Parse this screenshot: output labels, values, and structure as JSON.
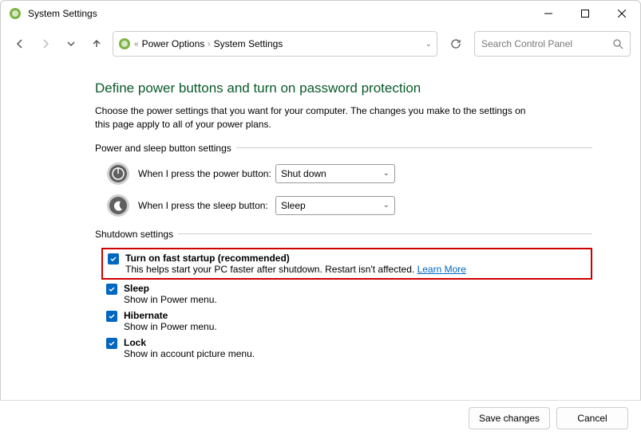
{
  "window": {
    "title": "System Settings"
  },
  "toolbar": {
    "breadcrumb": [
      "Power Options",
      "System Settings"
    ],
    "search_placeholder": "Search Control Panel"
  },
  "page": {
    "title": "Define power buttons and turn on password protection",
    "description": "Choose the power settings that you want for your computer. The changes you make to the settings on this page apply to all of your power plans."
  },
  "button_settings": {
    "legend": "Power and sleep button settings",
    "power": {
      "label": "When I press the power button:",
      "value": "Shut down"
    },
    "sleep": {
      "label": "When I press the sleep button:",
      "value": "Sleep"
    }
  },
  "shutdown": {
    "legend": "Shutdown settings",
    "fast_startup": {
      "label": "Turn on fast startup (recommended)",
      "desc": "This helps start your PC faster after shutdown. Restart isn't affected. ",
      "learn_more": "Learn More"
    },
    "sleep": {
      "label": "Sleep",
      "desc": "Show in Power menu."
    },
    "hibernate": {
      "label": "Hibernate",
      "desc": "Show in Power menu."
    },
    "lock": {
      "label": "Lock",
      "desc": "Show in account picture menu."
    }
  },
  "footer": {
    "save": "Save changes",
    "cancel": "Cancel"
  }
}
